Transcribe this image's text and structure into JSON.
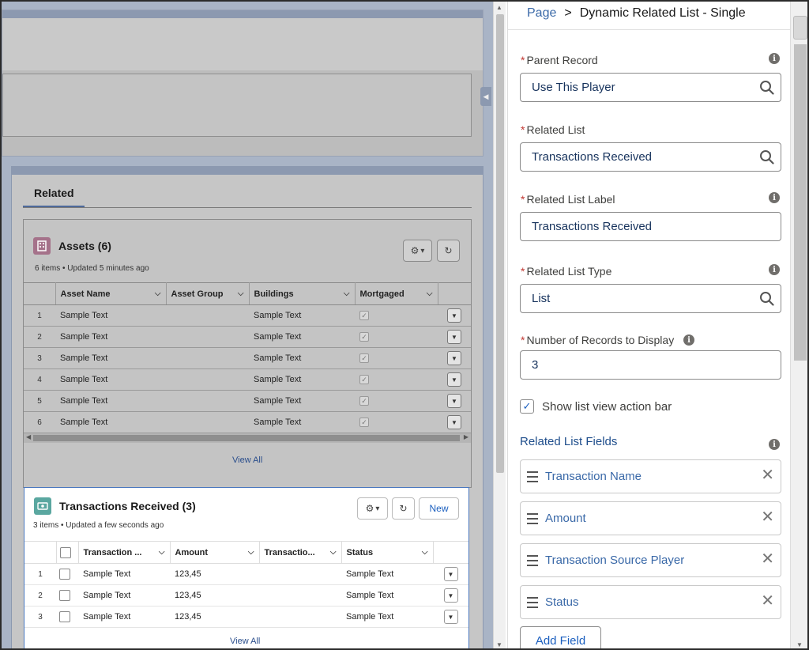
{
  "canvas": {
    "related_tab": "Related",
    "assets": {
      "title": "Assets (6)",
      "subtitle": "6 items • Updated 5 minutes ago",
      "columns": [
        "Asset Name",
        "Asset Group",
        "Buildings",
        "Mortgaged"
      ],
      "rows": [
        {
          "num": "1",
          "name": "Sample Text",
          "group": "",
          "buildings": "Sample Text"
        },
        {
          "num": "2",
          "name": "Sample Text",
          "group": "",
          "buildings": "Sample Text"
        },
        {
          "num": "3",
          "name": "Sample Text",
          "group": "",
          "buildings": "Sample Text"
        },
        {
          "num": "4",
          "name": "Sample Text",
          "group": "",
          "buildings": "Sample Text"
        },
        {
          "num": "5",
          "name": "Sample Text",
          "group": "",
          "buildings": "Sample Text"
        },
        {
          "num": "6",
          "name": "Sample Text",
          "group": "",
          "buildings": "Sample Text"
        }
      ],
      "view_all": "View All"
    },
    "transactions": {
      "title": "Transactions Received (3)",
      "subtitle": "3 items • Updated a few seconds ago",
      "new_label": "New",
      "columns": [
        "Transaction ...",
        "Amount",
        "Transactio...",
        "Status"
      ],
      "rows": [
        {
          "num": "1",
          "name": "Sample Text",
          "amount": "123,45",
          "source": "",
          "status": "Sample Text"
        },
        {
          "num": "2",
          "name": "Sample Text",
          "amount": "123,45",
          "source": "",
          "status": "Sample Text"
        },
        {
          "num": "3",
          "name": "Sample Text",
          "amount": "123,45",
          "source": "",
          "status": "Sample Text"
        }
      ],
      "view_all": "View All"
    }
  },
  "panel": {
    "breadcrumb": {
      "parent": "Page",
      "separator": ">",
      "current": "Dynamic Related List - Single"
    },
    "parent_record": {
      "label": "Parent Record",
      "value": "Use This Player"
    },
    "related_list": {
      "label": "Related List",
      "value": "Transactions Received"
    },
    "related_list_label": {
      "label": "Related List Label",
      "value": "Transactions Received"
    },
    "related_list_type": {
      "label": "Related List Type",
      "value": "List"
    },
    "num_records": {
      "label": "Number of Records to Display",
      "value": "3"
    },
    "show_action_bar": {
      "label": "Show list view action bar",
      "checked": true
    },
    "fields_title": "Related List Fields",
    "fields": [
      "Transaction Name",
      "Amount",
      "Transaction Source Player",
      "Status"
    ],
    "add_field_label": "Add Field"
  },
  "colors": {
    "accent": "#1b5fbf",
    "link": "#3a69a8",
    "required": "#c23934",
    "asset_icon": "#a5728a",
    "transaction_icon": "#5aa7a0"
  }
}
